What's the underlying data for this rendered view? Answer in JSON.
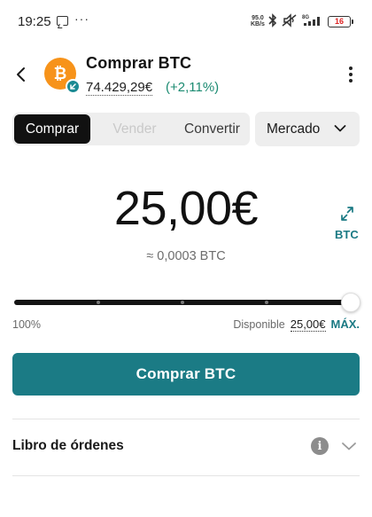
{
  "status_bar": {
    "time": "19:25",
    "net_speed_value": "95.0",
    "net_speed_unit": "KB/s",
    "battery": "16"
  },
  "header": {
    "title": "Comprar BTC",
    "price": "74.429,29€",
    "change": "(+2,11%)",
    "coin_icon": "bitcoin-icon"
  },
  "tabs": [
    {
      "label": "Comprar",
      "active": true
    },
    {
      "label": "Vender",
      "active": false,
      "disabled": true
    },
    {
      "label": "Convertir",
      "active": false
    }
  ],
  "order_type": {
    "selected": "Mercado"
  },
  "amount": {
    "value": "25,00€",
    "approx": "≈ 0,0003 BTC",
    "swap_label": "BTC"
  },
  "slider": {
    "percent_label": "100%",
    "level": 1.0,
    "ticks": [
      0.25,
      0.5,
      0.75
    ]
  },
  "available": {
    "label": "Disponible",
    "amount": "25,00€",
    "max_label": "MÁX."
  },
  "primary_button": {
    "label": "Comprar BTC"
  },
  "orderbook": {
    "label": "Libro de órdenes"
  },
  "colors": {
    "accent": "#1b7b85",
    "positive": "#1c8b72",
    "bitcoin": "#f7931a",
    "active_tab": "#111111"
  }
}
